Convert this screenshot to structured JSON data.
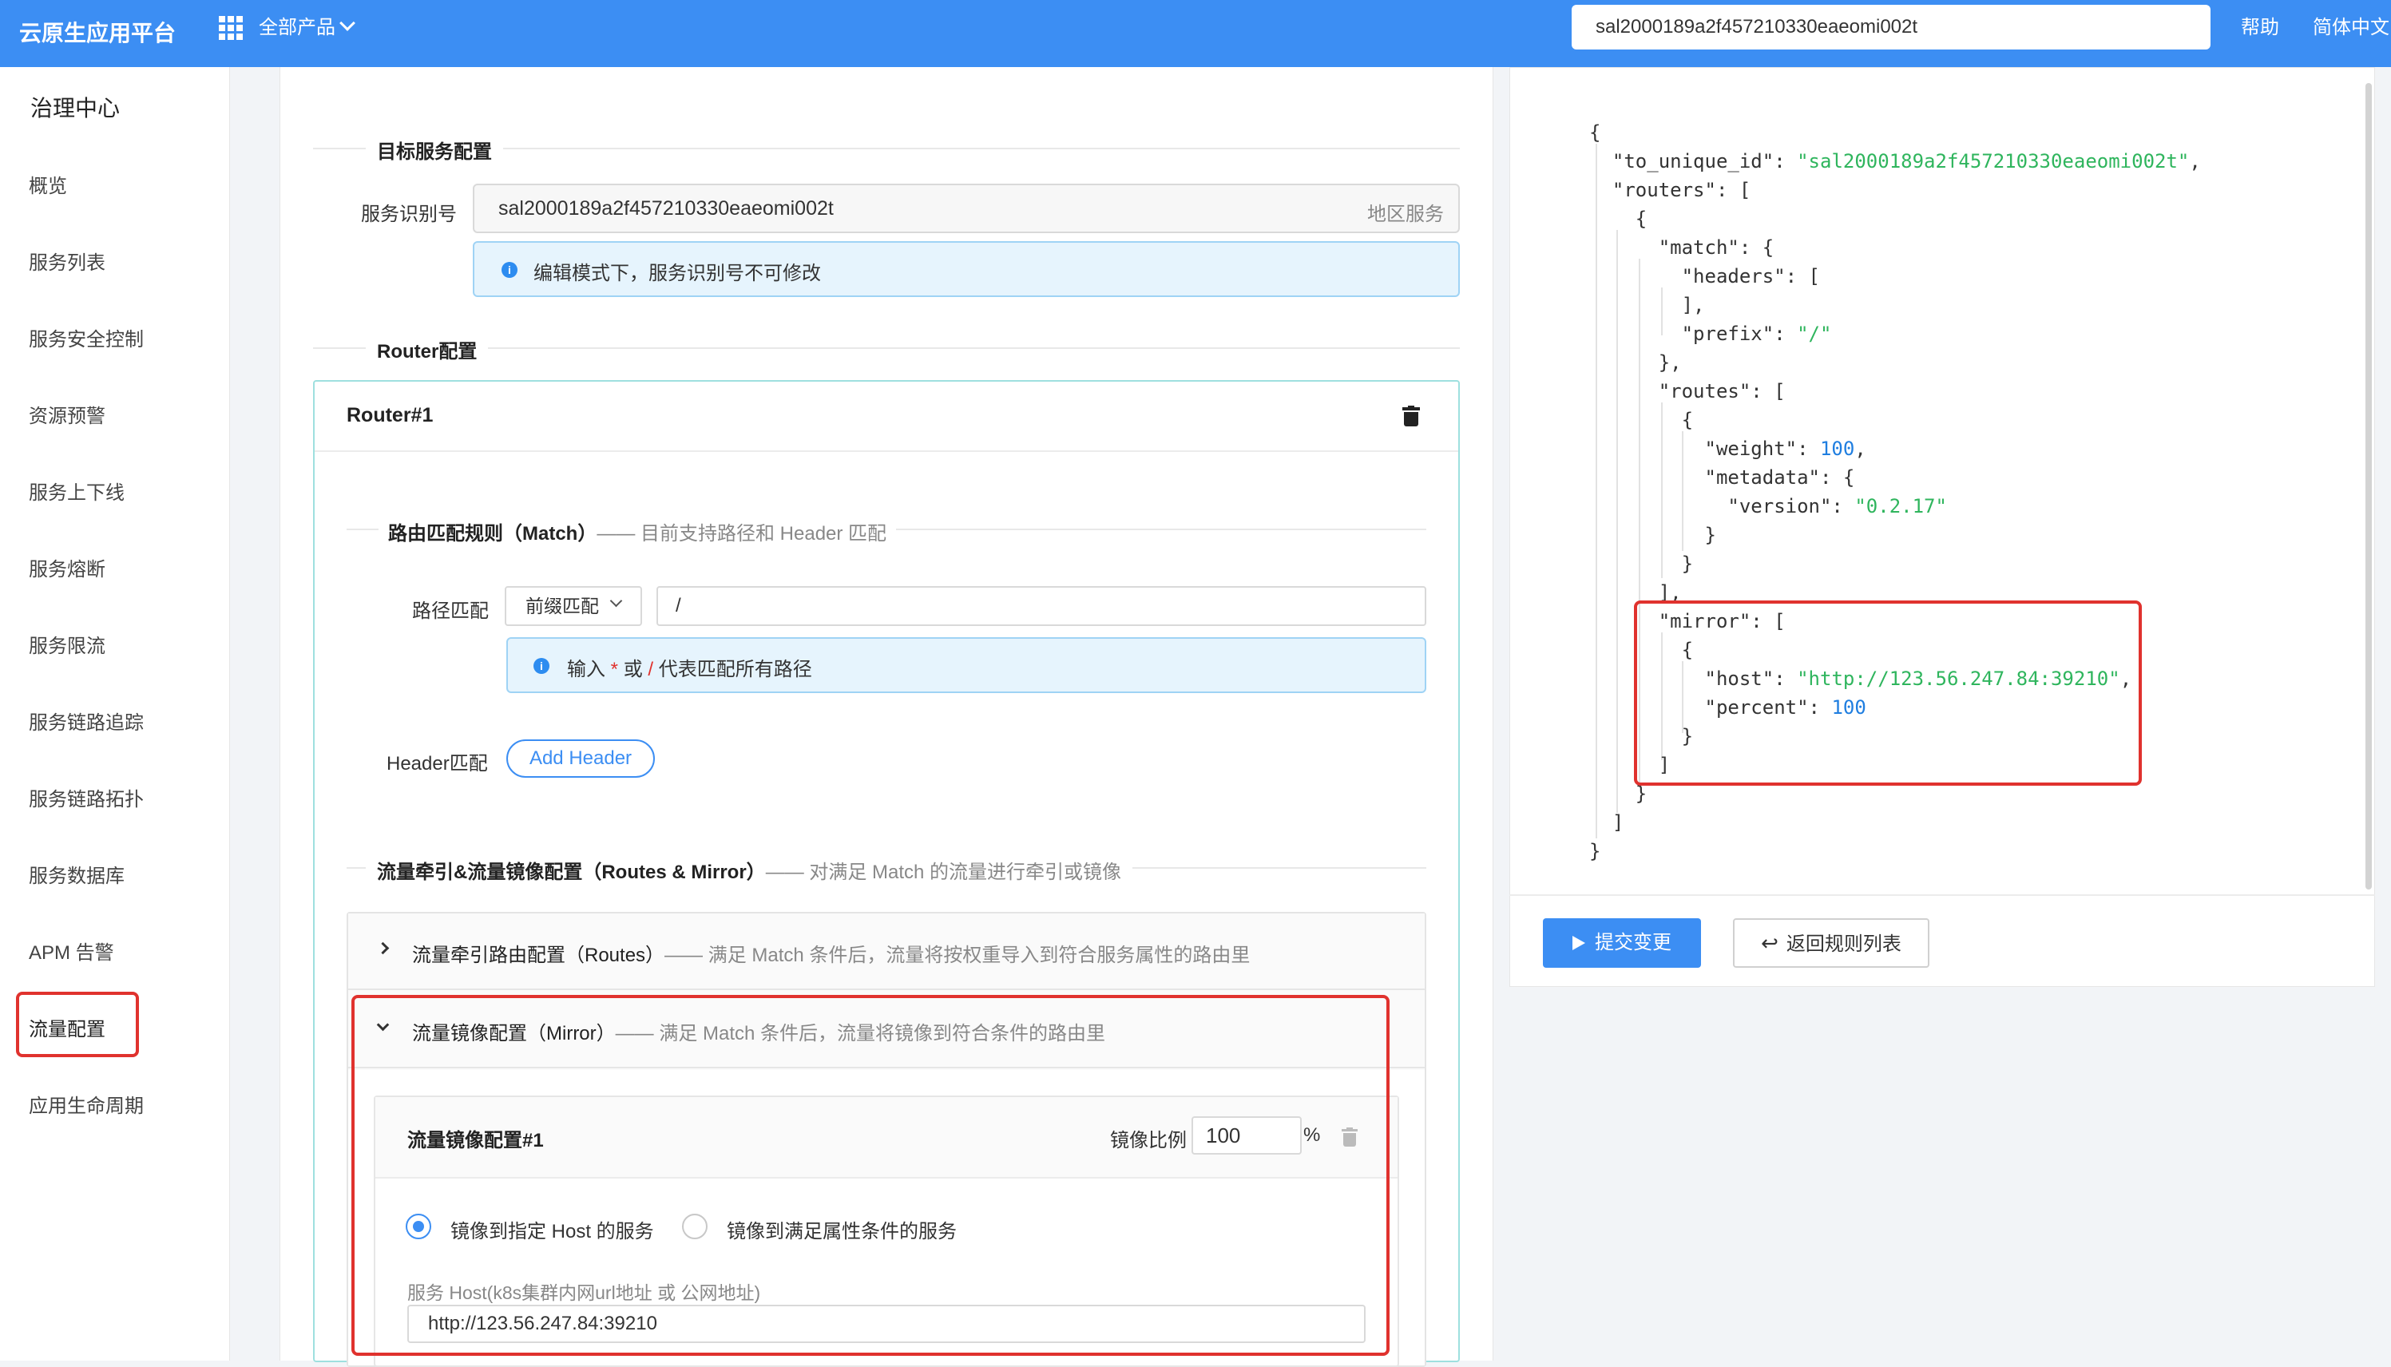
{
  "header": {
    "app_title": "云原生应用平台",
    "all_products": "全部产品",
    "search_value": "sal2000189a2f457210330eaeomi002t",
    "help": "帮助",
    "language": "简体中文"
  },
  "sidebar": {
    "title": "治理中心",
    "items": [
      "概览",
      "服务列表",
      "服务安全控制",
      "资源预警",
      "服务上下线",
      "服务熔断",
      "服务限流",
      "服务链路追踪",
      "服务链路拓扑",
      "服务数据库",
      "APM 告警",
      "流量配置",
      "应用生命周期"
    ],
    "active_item": "流量配置"
  },
  "target": {
    "section_title": "目标服务配置",
    "label": "服务识别号",
    "value": "sal2000189a2f457210330eaeomi002t",
    "suffix": "地区服务",
    "info": "编辑模式下，服务识别号不可修改"
  },
  "router": {
    "section_title": "Router配置",
    "card_title": "Router#1",
    "match_title": "路由匹配规则（Match）",
    "match_desc": "—— 目前支持路径和 Header 匹配",
    "path_label": "路径匹配",
    "path_type": "前缀匹配",
    "path_value": "/",
    "path_info_prefix": "输入",
    "path_info_star": "*",
    "path_info_or": "或",
    "path_info_slash": "/",
    "path_info_suffix": "代表匹配所有路径",
    "header_label": "Header匹配",
    "add_header": "Add Header",
    "routes_mirror_title": "流量牵引&流量镜像配置（Routes & Mirror）",
    "routes_mirror_desc": "—— 对满足 Match 的流量进行牵引或镜像",
    "routes_panel_title": "流量牵引路由配置（Routes）",
    "routes_panel_desc": "—— 满足 Match 条件后，流量将按权重导入到符合服务属性的路由里",
    "mirror_panel_title": "流量镜像配置（Mirror）",
    "mirror_panel_desc": "—— 满足 Match 条件后，流量将镜像到符合条件的路由里",
    "mirror_card_title": "流量镜像配置#1",
    "mirror_ratio_label": "镜像比例",
    "mirror_ratio_value": "100",
    "mirror_ratio_unit": "%",
    "radio_host": "镜像到指定 Host 的服务",
    "radio_attr": "镜像到满足属性条件的服务",
    "radio_selected": "host",
    "host_label": "服务 Host(k8s集群内网url地址 或 公网地址)",
    "host_value": "http://123.56.247.84:39210"
  },
  "json_preview": {
    "to_unique_id": "sal2000189a2f457210330eaeomi002t",
    "prefix": "/",
    "weight": "100",
    "version": "0.2.17",
    "mirror_host": "http://123.56.247.84:39210",
    "mirror_percent": "100"
  },
  "actions": {
    "submit": "提交变更",
    "back": "返回规则列表"
  },
  "colors": {
    "primary": "#3c8ef3",
    "highlight": "#e0322e",
    "json_string": "#2fb55d",
    "json_number": "#1f7ee0"
  }
}
